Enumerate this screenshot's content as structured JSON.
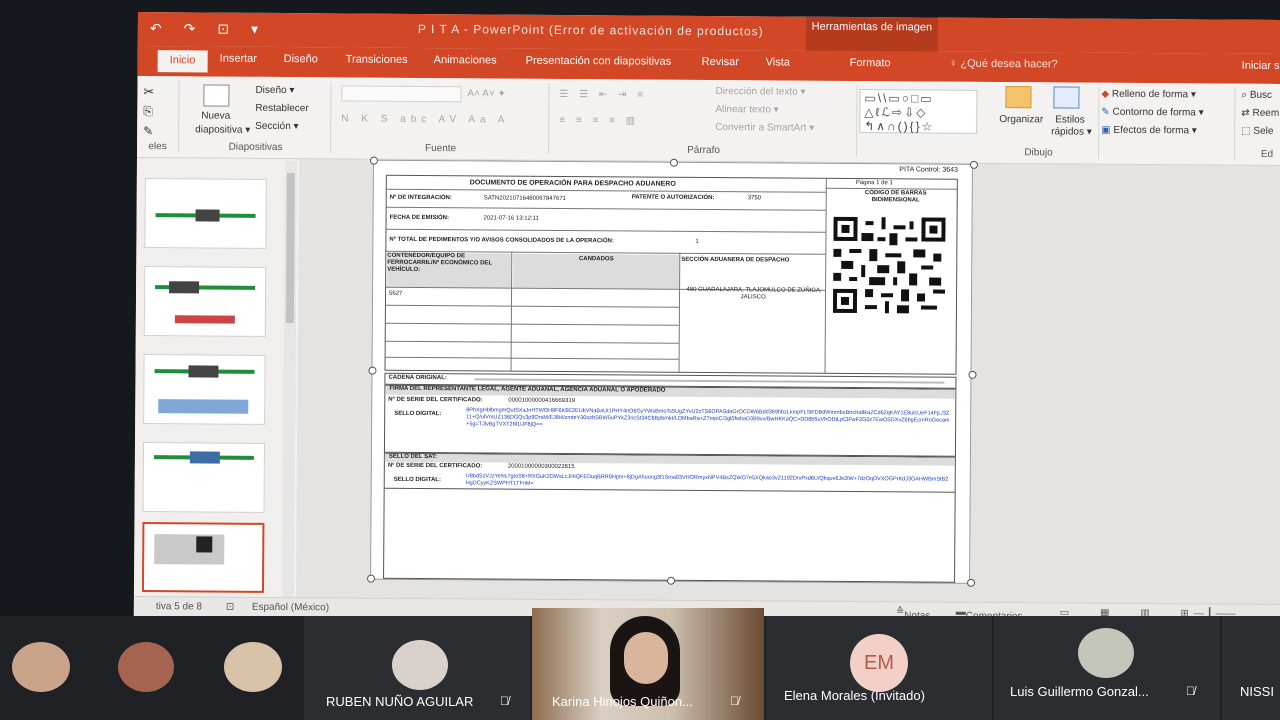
{
  "window": {
    "title": "P I T A  -  PowerPoint (Error de activación de productos)",
    "context_tab_group": "Herramientas de imagen",
    "tell_me": "¿Qué desea hacer?",
    "sign_in": "Iniciar sesi"
  },
  "tabs": [
    "Inicio",
    "Insertar",
    "Diseño",
    "Transiciones",
    "Animaciones",
    "Presentación con diapositivas",
    "Revisar",
    "Vista",
    "Formato"
  ],
  "ribbon": {
    "slides_group": {
      "new_slide": "Nueva",
      "new_slide_2": "diapositiva ▾",
      "layout": "Diseño ▾",
      "reset": "Restablecer",
      "section": "Sección ▾",
      "label": "Diapositivas"
    },
    "clipboard_label": "eles",
    "font_label": "Fuente",
    "paragraph": {
      "text_direction": "Dirección del texto ▾",
      "align_text": "Alinear texto ▾",
      "smartart": "Convertir a SmartArt ▾",
      "label": "Párrafo"
    },
    "drawing": {
      "arrange": "Organizar",
      "styles": "Estilos",
      "styles_2": "rápidos ▾",
      "fill": "Relleno de forma ▾",
      "outline": "Contorno de forma ▾",
      "effects": "Efectos de forma ▾",
      "label": "Dibujo"
    },
    "editing": {
      "find": "Busc",
      "replace": "Reem",
      "select": "Sele",
      "label": "Ed"
    }
  },
  "document": {
    "control": "PITA Control: 3643",
    "page": "Página 1 de 1",
    "title": "DOCUMENTO DE OPERACIÓN PARA DESPACHO ADUANERO",
    "qr_heading": "CÓDIGO DE BARRAS BIDIMENSIONAL",
    "integration_label": "Nº DE INTEGRACIÓN:",
    "integration_value": "SATN20210716480067847671",
    "patent_label": "PATENTE O AUTORIZACIÓN:",
    "patent_value": "3750",
    "issue_label": "FECHA DE EMISIÓN:",
    "issue_value": "2021-07-16 13:12:11",
    "total_label": "Nº TOTAL DE PEDIMENTOS Y/O AVISOS CONSOLIDADOS DE LA OPERACIÓN:",
    "total_value": "1",
    "col_container": "CONTENEDOR/EQUIPO DE FERROCARRIL/Nº ECONÓMICO DEL VEHÍCULO:",
    "col_locks": "CANDADOS",
    "col_section": "SECCIÓN ADUANERA DE DESPACHO",
    "container_value": "5627",
    "section_value": "480 GUADALAJARA, TLAJOMULCO DE ZÚÑIGA, JALISCO.",
    "chain_label": "CADENA ORIGINAL:",
    "rep_heading": "FIRMA DEL REPRESENTANTE LEGAL, AGENTE ADUANAL, AGENCIA ADUANAL O APODERADO",
    "cert_label": "Nº DE SERIE DEL CERTIFICADO:",
    "cert_value": "00001000000416669319",
    "seal_label": "SELLO DIGITAL:",
    "seal_value": "8PhXgHblbmgmQutSXaJnHTWOH8F6K6E2EUbVNaBaUt1PHY4nO6GyYWsBmoTs5UgZYvU2zTS6OPASdaGrOCDW6Bdd369hbzLkmpFL!9FDBdWmmbzBtrcha8kaZCd62qKAY1E8ulcUeF14FjL/3Z11+Q/ulVmUZ136DGQc3p9OrsM/EJ8i4/zmteY30ozbSBW5uPYkZ3ncSt34C6Bpbmkt/LOMbaRa+ZTmpiC/3gl0fwhaD3B9xv/BwHKKaQC=DD8b5uVhODtLpClFwF2G0z7EwOSDXvZ6bgEcmRoGecam+5g=TJlvBgTVXT2M1lJF8jQ==",
    "sat_heading": "SELLO DEL SAT:",
    "sat_cert_value": "20001000000300022815",
    "sat_seal_value": "U8bdSzVJzYeNc7gtoS8+RXGuK2DWsLcJHIQFEDuqBRR0Hpm+8jDgAhuong3f1Sma03VHORmyxNPV4BsZQWO7e5XQkao3vZ1192DrvPxd6U/Qkquv6Je2lW+7dzOqDVXOGPrKdJ3GAHWBmStB2HgDCyyKZSWPHT1TFnM="
  },
  "status_bar": {
    "slide_info": "tiva 5 de 8",
    "language": "Español (México)",
    "notes": "Notas",
    "comments": "Comentarios"
  },
  "participants": [
    {
      "name": "RUBEN NUÑO AGUILAR"
    },
    {
      "name": "Karina Hinojos Quiñon..."
    },
    {
      "name": "Elena Morales (Invitado)",
      "initials": "EM"
    },
    {
      "name": "Luis Guillermo Gonzal..."
    },
    {
      "name": "NISSI"
    }
  ],
  "colors": {
    "ppt_accent": "#d24726",
    "slide_band": "#1d8f3b",
    "teams_bg": "#1f2125"
  }
}
